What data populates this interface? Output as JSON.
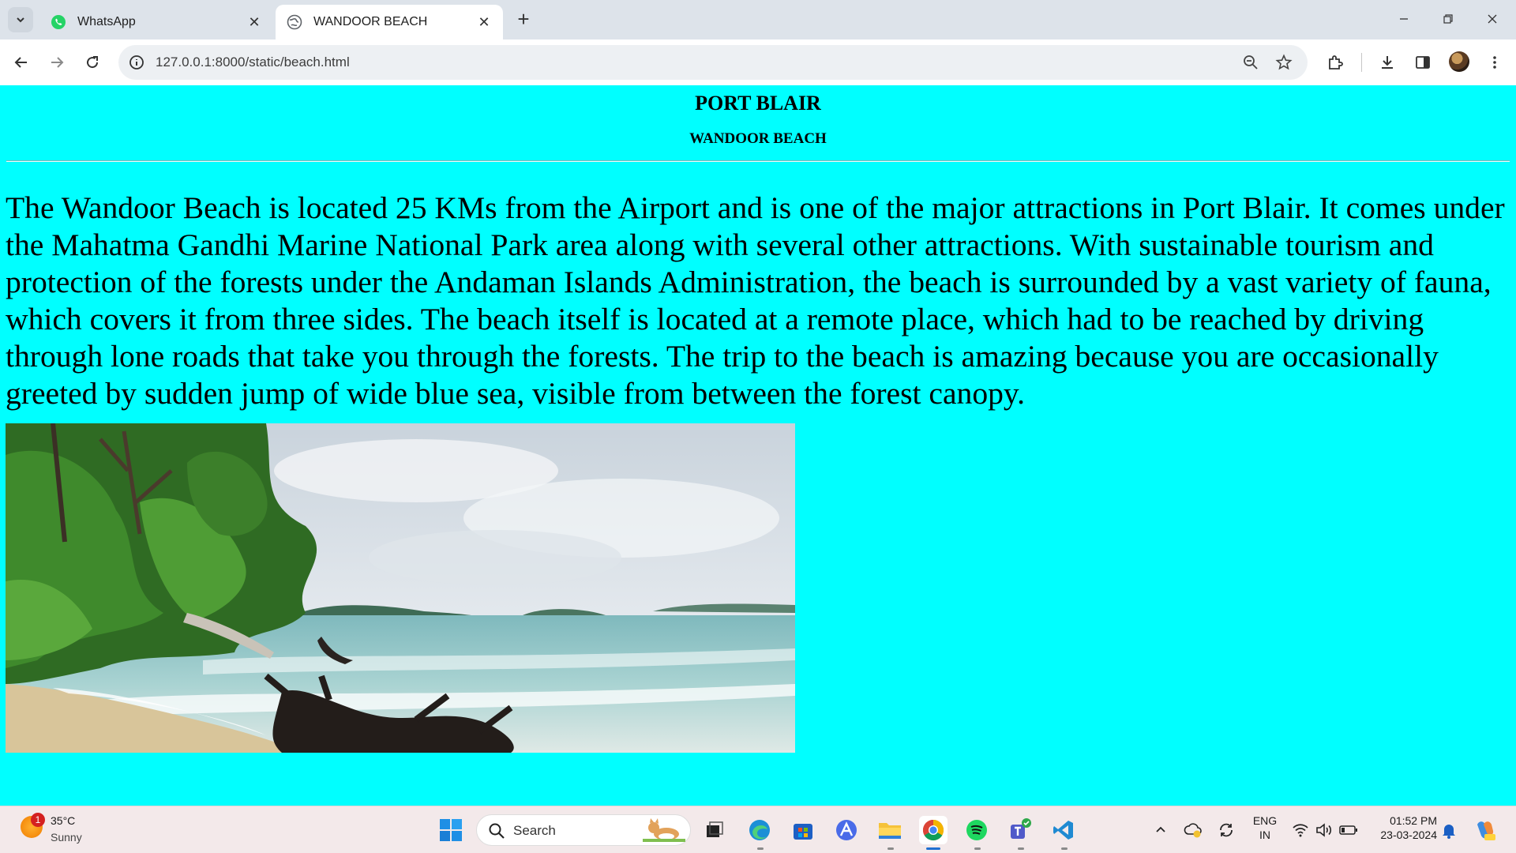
{
  "browser": {
    "tabs": [
      {
        "title": "WhatsApp",
        "active": false
      },
      {
        "title": "WANDOOR BEACH",
        "active": true
      }
    ],
    "url": "127.0.0.1:8000/static/beach.html"
  },
  "page": {
    "heading": "PORT BLAIR",
    "subheading": "WANDOOR BEACH",
    "paragraph": "The Wandoor Beach is located 25 KMs from the Airport and is one of the major attractions in Port Blair. It comes under the Mahatma Gandhi Marine National Park area along with several other attractions. With sustainable tourism and protection of the forests under the Andaman Islands Administration, the beach is surrounded by a vast variety of fauna, which covers it from three sides. The beach itself is located at a remote place, which had to be reached by driving through lone roads that take you through the forests. The trip to the beach is amazing because you are occasionally greeted by sudden jump of wide blue sea, visible from between the forest canopy.",
    "background_color": "#00ffff"
  },
  "taskbar": {
    "weather": {
      "temp": "35°C",
      "condition": "Sunny",
      "badge": "1"
    },
    "search_label": "Search",
    "language": {
      "line1": "ENG",
      "line2": "IN"
    },
    "clock": {
      "time": "01:52 PM",
      "date": "23-03-2024"
    },
    "apps": [
      "start-icon",
      "task-view-icon",
      "edge-icon",
      "store-icon",
      "copilot-icon",
      "file-explorer-icon",
      "chrome-icon",
      "spotify-icon",
      "teams-icon",
      "vscode-icon"
    ]
  }
}
